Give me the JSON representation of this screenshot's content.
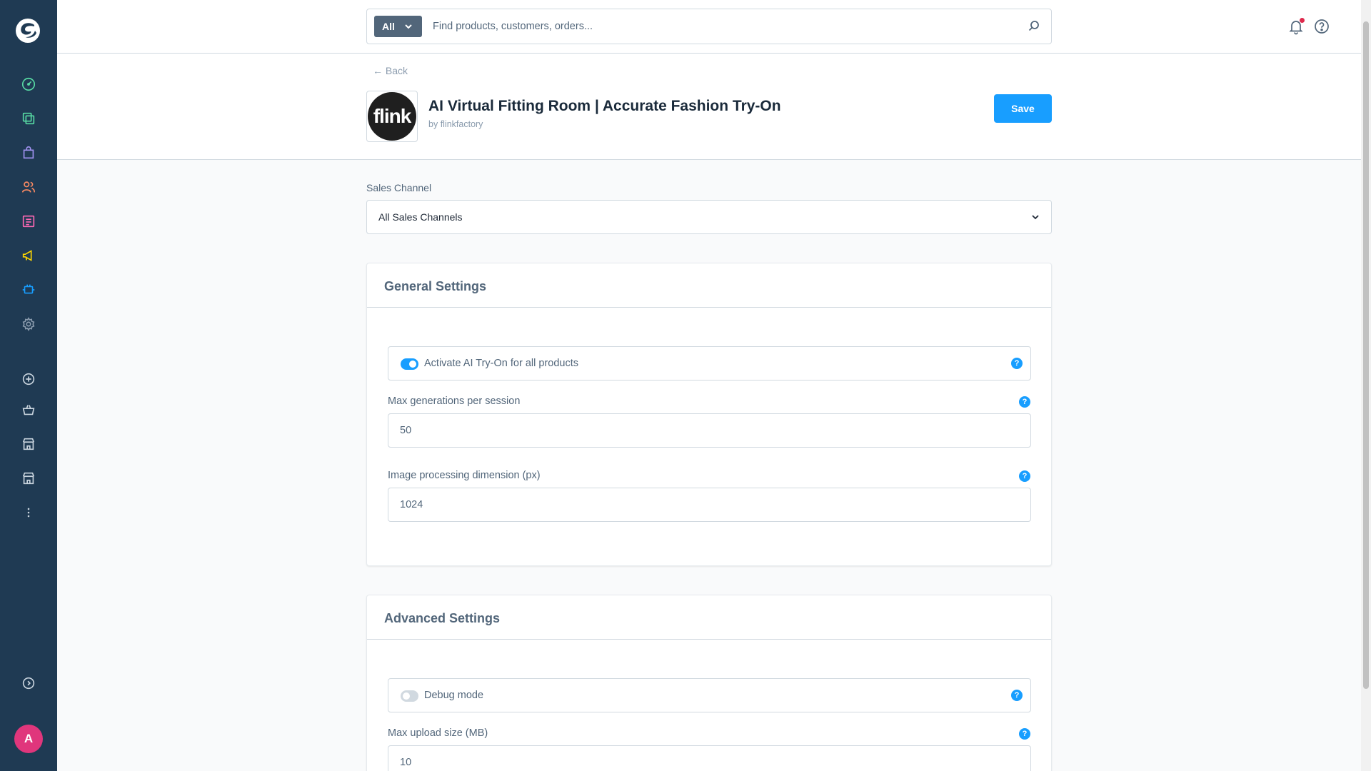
{
  "search": {
    "type_label": "All",
    "placeholder": "Find products, customers, orders..."
  },
  "user": {
    "avatar_initial": "A"
  },
  "header": {
    "back_label": "← Back",
    "app_logo_text": "flink",
    "app_title": "AI Virtual Fitting Room | Accurate Fashion Try-On",
    "vendor_prefix": "by",
    "vendor_name": "flinkfactory",
    "save_label": "Save"
  },
  "sales_channel": {
    "label": "Sales Channel",
    "value": "All Sales Channels"
  },
  "general_settings": {
    "title": "General Settings",
    "activate_toggle": {
      "label": "Activate AI Try-On for all products",
      "enabled": true
    },
    "max_generations": {
      "label": "Max generations per session",
      "value": "50"
    },
    "image_dimension": {
      "label": "Image processing dimension (px)",
      "value": "1024"
    }
  },
  "advanced_settings": {
    "title": "Advanced Settings",
    "debug_toggle": {
      "label": "Debug mode",
      "enabled": false
    },
    "max_upload": {
      "label": "Max upload size (MB)",
      "value": "10"
    }
  },
  "help_glyph": "?",
  "colors": {
    "sidebar_bg": "#1f3a53",
    "primary": "#189eff",
    "avatar": "#e0367c"
  },
  "sidebar_icons": [
    "dashboard-icon",
    "catalogue-icon",
    "orders-icon",
    "customers-icon",
    "content-icon",
    "marketing-icon",
    "extensions-icon",
    "settings-icon",
    "add-sales-channel-icon",
    "storefront-icon",
    "sales-channel-store-icon",
    "sales-channel-store-2-icon",
    "more-icon",
    "collapse-icon"
  ]
}
